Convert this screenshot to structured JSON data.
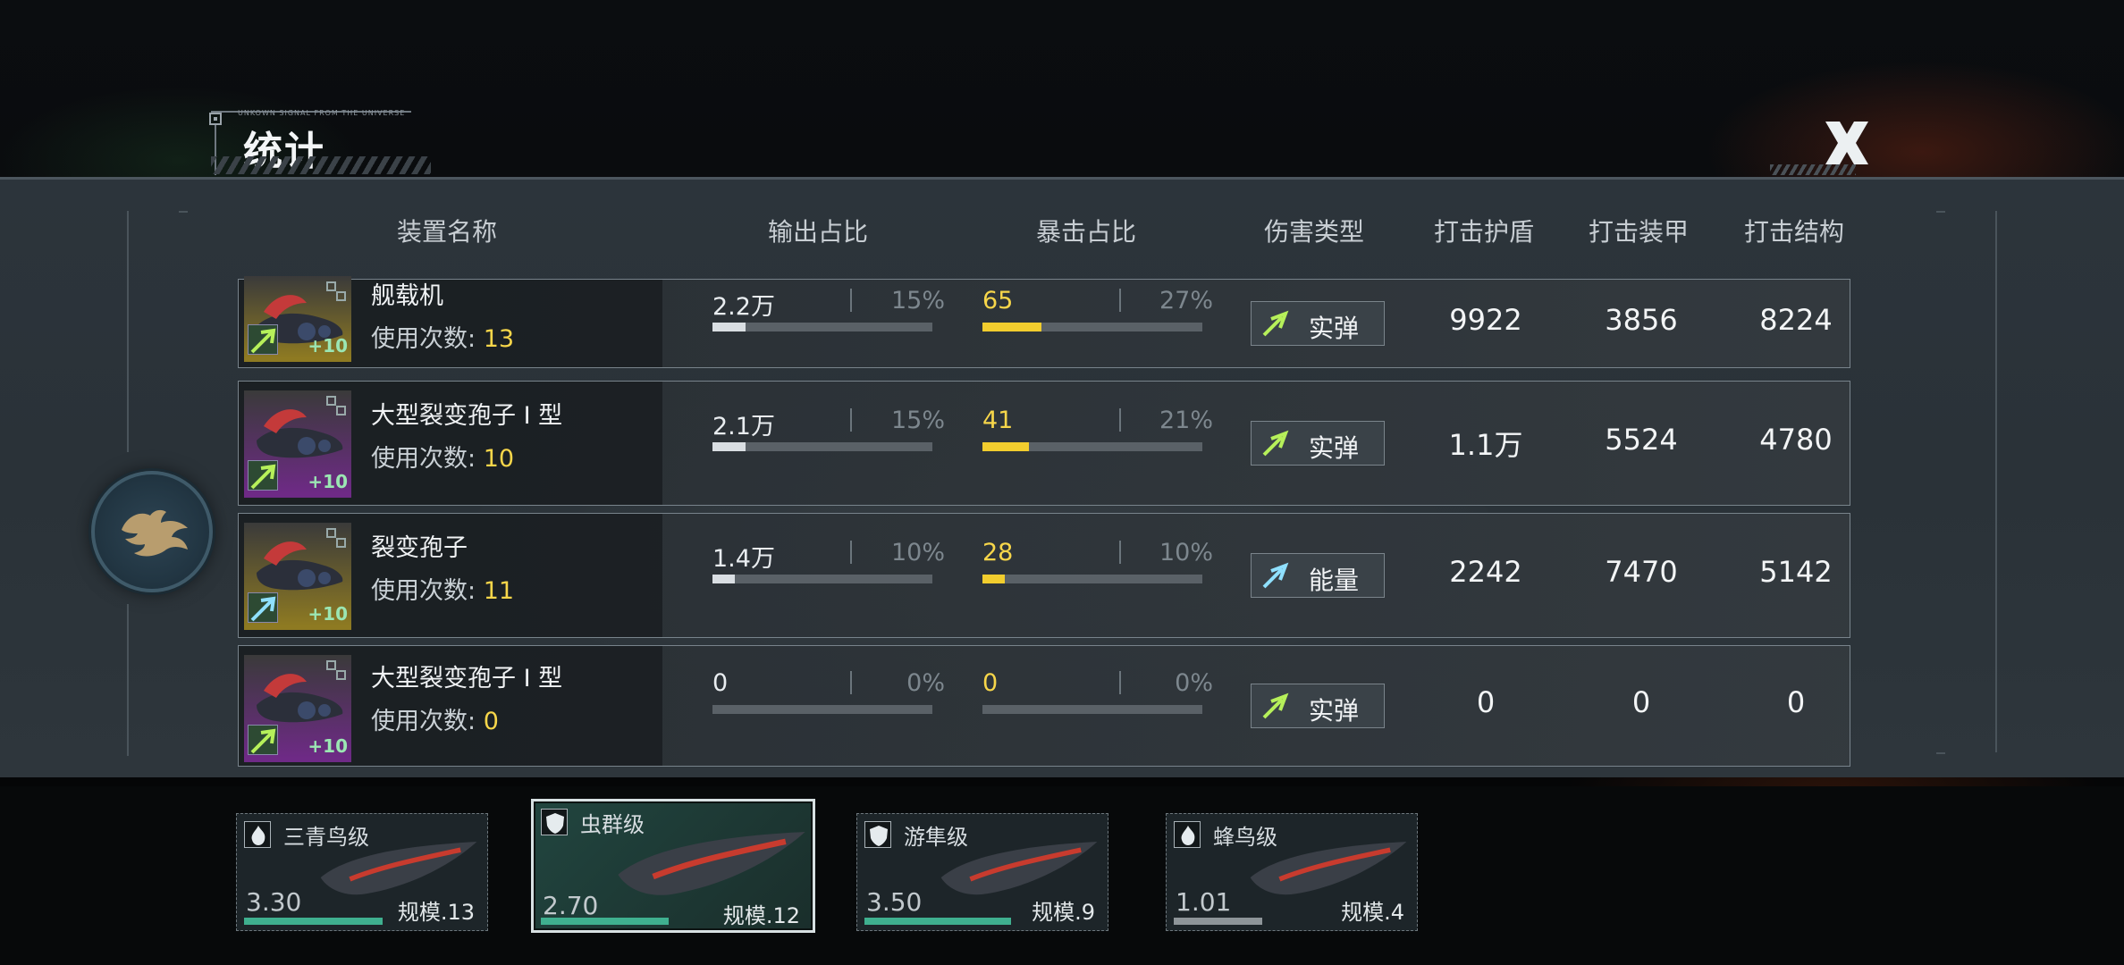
{
  "title": "统计",
  "title_decoration_text": "UNKOWN SIGNAL FROM THE UNIVERSE",
  "columns": [
    "装置名称",
    "输出占比",
    "暴击占比",
    "伤害类型",
    "打击护盾",
    "打击装甲",
    "打击结构"
  ],
  "uses_label": "使用次数: ",
  "rows": [
    {
      "name": "舰载机",
      "uses": "13",
      "level": "+10",
      "rarity_color": "#8e7a22",
      "output_value": "2.2万",
      "output_pct": "15%",
      "output_fill": 0.15,
      "crit_value": "65",
      "crit_pct": "27%",
      "crit_fill": 0.27,
      "damage_type": "实弹",
      "damage_icon": "kinetic-icon",
      "shield": "9922",
      "armor": "3856",
      "structure": "8224"
    },
    {
      "name": "大型裂变孢子 I 型",
      "uses": "10",
      "level": "+10",
      "rarity_color": "#6e2a86",
      "output_value": "2.1万",
      "output_pct": "15%",
      "output_fill": 0.15,
      "crit_value": "41",
      "crit_pct": "21%",
      "crit_fill": 0.21,
      "damage_type": "实弹",
      "damage_icon": "kinetic-icon",
      "shield": "1.1万",
      "armor": "5524",
      "structure": "4780"
    },
    {
      "name": "裂变孢子",
      "uses": "11",
      "level": "+10",
      "rarity_color": "#8e7a22",
      "output_value": "1.4万",
      "output_pct": "10%",
      "output_fill": 0.1,
      "crit_value": "28",
      "crit_pct": "10%",
      "crit_fill": 0.1,
      "damage_type": "能量",
      "damage_icon": "energy-icon",
      "shield": "2242",
      "armor": "7470",
      "structure": "5142"
    },
    {
      "name": "大型裂变孢子 I 型",
      "uses": "0",
      "level": "+10",
      "rarity_color": "#6e2a86",
      "output_value": "0",
      "output_pct": "0%",
      "output_fill": 0,
      "crit_value": "0",
      "crit_pct": "0%",
      "crit_fill": 0,
      "damage_type": "实弹",
      "damage_icon": "kinetic-icon",
      "shield": "0",
      "armor": "0",
      "structure": "0"
    }
  ],
  "ships": [
    {
      "name": "三青鸟级",
      "value": "3.30",
      "scale": "规模.13",
      "icon": "flame-icon",
      "bar_fill": 0.55,
      "bar_color": "#3fb08f",
      "selected": false
    },
    {
      "name": "虫群级",
      "value": "2.70",
      "scale": "规模.12",
      "icon": "shield-icon",
      "bar_fill": 0.45,
      "bar_color": "#3fb08f",
      "selected": true
    },
    {
      "name": "游隼级",
      "value": "3.50",
      "scale": "规模.9",
      "icon": "shield-icon",
      "bar_fill": 0.58,
      "bar_color": "#3fb08f",
      "selected": false
    },
    {
      "name": "蜂鸟级",
      "value": "1.01",
      "scale": "规模.4",
      "icon": "flame-icon",
      "bar_fill": 0.35,
      "bar_color": "#8e9599",
      "selected": false
    }
  ],
  "colors": {
    "accent_yellow": "#f7d64a",
    "output_fill": "#d9dee2",
    "crit_fill": "#f2cd2e"
  }
}
